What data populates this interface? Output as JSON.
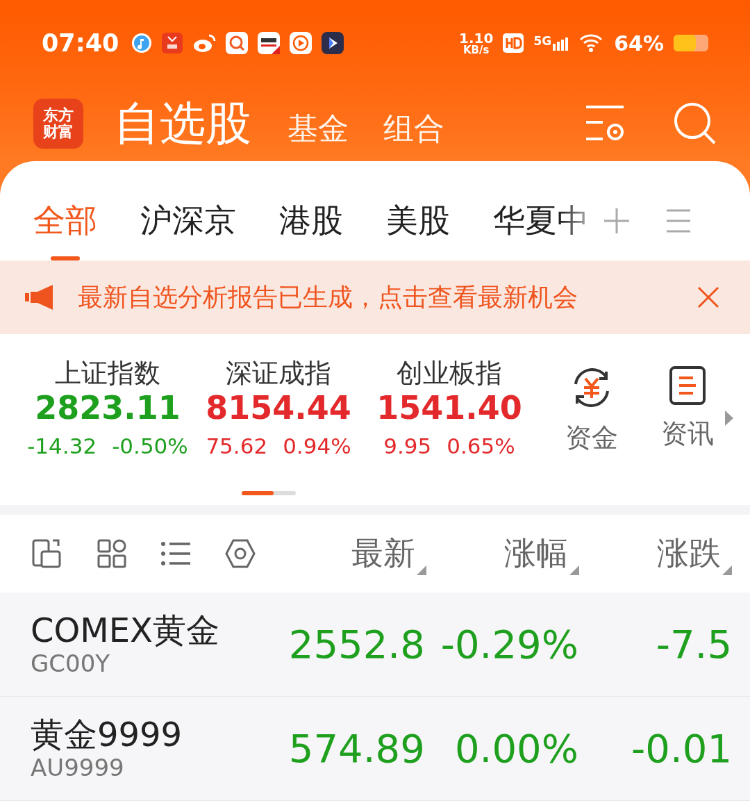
{
  "status_bar": {
    "time": "07:40",
    "net_speed": "1.10",
    "net_unit": "KB/s",
    "network": "5G",
    "battery": "64%"
  },
  "header": {
    "logo": [
      "东方",
      "财富"
    ],
    "title": "自选股",
    "links": [
      "基金",
      "组合"
    ]
  },
  "tabs": [
    {
      "label": "全部",
      "selected": true
    },
    {
      "label": "沪深京",
      "selected": false
    },
    {
      "label": "港股",
      "selected": false
    },
    {
      "label": "美股",
      "selected": false
    },
    {
      "label": "华夏中",
      "selected": false
    }
  ],
  "banner": {
    "text": "最新自选分析报告已生成，点击查看最新机会"
  },
  "indices": [
    {
      "name": "上证指数",
      "value": "2823.11",
      "change": "-14.32",
      "change_pct": "-0.50%",
      "color": "#1ea01e"
    },
    {
      "name": "深证成指",
      "value": "8154.44",
      "change": "75.62",
      "change_pct": "0.94%",
      "color": "#e3292b"
    },
    {
      "name": "创业板指",
      "value": "1541.40",
      "change": "9.95",
      "change_pct": "0.65%",
      "color": "#e3292b"
    }
  ],
  "shortcuts": [
    {
      "label": "资金",
      "kind": "money"
    },
    {
      "label": "资讯",
      "kind": "news"
    }
  ],
  "columns": [
    "最新",
    "涨幅",
    "涨跌"
  ],
  "rows": [
    {
      "name": "COMEX黄金",
      "code": "GC00Y",
      "price": "2552.8",
      "change_pct": "-0.29%",
      "change": "-7.5",
      "color": "#1ea01e"
    },
    {
      "name": "黄金9999",
      "code": "AU9999",
      "price": "574.89",
      "change_pct": "0.00%",
      "change": "-0.01",
      "color": "#1ea01e"
    }
  ]
}
